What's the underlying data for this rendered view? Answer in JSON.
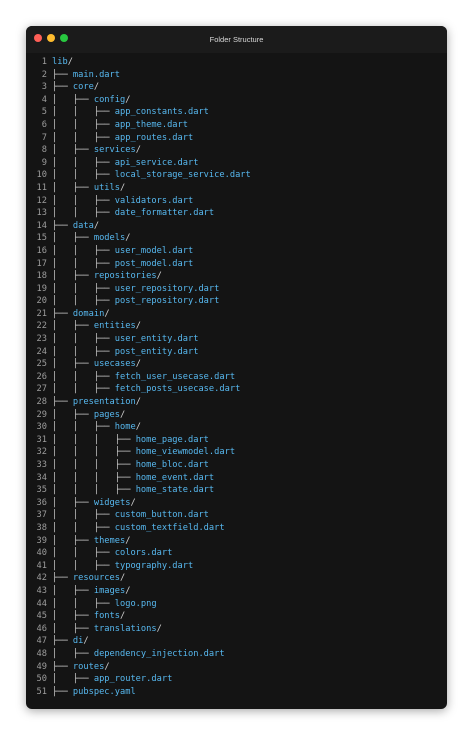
{
  "window": {
    "title": "Folder Structure",
    "controls": [
      {
        "name": "close-dot",
        "color": "#ff5f57"
      },
      {
        "name": "minimize-dot",
        "color": "#febc2e"
      },
      {
        "name": "maximize-dot",
        "color": "#28c840"
      }
    ]
  },
  "colors": {
    "background": "#141414",
    "names": "#57b8ef",
    "tree": "#d2d2d2",
    "line_numbers": "#9c9c9c"
  },
  "lines": [
    {
      "n": "1",
      "prefix": "",
      "name": "lib",
      "slash": "/"
    },
    {
      "n": "2",
      "prefix": "├── ",
      "name": "main.dart",
      "slash": ""
    },
    {
      "n": "3",
      "prefix": "├── ",
      "name": "core",
      "slash": "/"
    },
    {
      "n": "4",
      "prefix": "│   ├── ",
      "name": "config",
      "slash": "/"
    },
    {
      "n": "5",
      "prefix": "│   │   ├── ",
      "name": "app_constants.dart",
      "slash": ""
    },
    {
      "n": "6",
      "prefix": "│   │   ├── ",
      "name": "app_theme.dart",
      "slash": ""
    },
    {
      "n": "7",
      "prefix": "│   │   ├── ",
      "name": "app_routes.dart",
      "slash": ""
    },
    {
      "n": "8",
      "prefix": "│   ├── ",
      "name": "services",
      "slash": "/"
    },
    {
      "n": "9",
      "prefix": "│   │   ├── ",
      "name": "api_service.dart",
      "slash": ""
    },
    {
      "n": "10",
      "prefix": "│   │   ├── ",
      "name": "local_storage_service.dart",
      "slash": ""
    },
    {
      "n": "11",
      "prefix": "│   ├── ",
      "name": "utils",
      "slash": "/"
    },
    {
      "n": "12",
      "prefix": "│   │   ├── ",
      "name": "validators.dart",
      "slash": ""
    },
    {
      "n": "13",
      "prefix": "│   │   ├── ",
      "name": "date_formatter.dart",
      "slash": ""
    },
    {
      "n": "14",
      "prefix": "├── ",
      "name": "data",
      "slash": "/"
    },
    {
      "n": "15",
      "prefix": "│   ├── ",
      "name": "models",
      "slash": "/"
    },
    {
      "n": "16",
      "prefix": "│   │   ├── ",
      "name": "user_model.dart",
      "slash": ""
    },
    {
      "n": "17",
      "prefix": "│   │   ├── ",
      "name": "post_model.dart",
      "slash": ""
    },
    {
      "n": "18",
      "prefix": "│   ├── ",
      "name": "repositories",
      "slash": "/"
    },
    {
      "n": "19",
      "prefix": "│   │   ├── ",
      "name": "user_repository.dart",
      "slash": ""
    },
    {
      "n": "20",
      "prefix": "│   │   ├── ",
      "name": "post_repository.dart",
      "slash": ""
    },
    {
      "n": "21",
      "prefix": "├── ",
      "name": "domain",
      "slash": "/"
    },
    {
      "n": "22",
      "prefix": "│   ├── ",
      "name": "entities",
      "slash": "/"
    },
    {
      "n": "23",
      "prefix": "│   │   ├── ",
      "name": "user_entity.dart",
      "slash": ""
    },
    {
      "n": "24",
      "prefix": "│   │   ├── ",
      "name": "post_entity.dart",
      "slash": ""
    },
    {
      "n": "25",
      "prefix": "│   ├── ",
      "name": "usecases",
      "slash": "/"
    },
    {
      "n": "26",
      "prefix": "│   │   ├── ",
      "name": "fetch_user_usecase.dart",
      "slash": ""
    },
    {
      "n": "27",
      "prefix": "│   │   ├── ",
      "name": "fetch_posts_usecase.dart",
      "slash": ""
    },
    {
      "n": "28",
      "prefix": "├── ",
      "name": "presentation",
      "slash": "/"
    },
    {
      "n": "29",
      "prefix": "│   ├── ",
      "name": "pages",
      "slash": "/"
    },
    {
      "n": "30",
      "prefix": "│   │   ├── ",
      "name": "home",
      "slash": "/"
    },
    {
      "n": "31",
      "prefix": "│   │   │   ├── ",
      "name": "home_page.dart",
      "slash": ""
    },
    {
      "n": "32",
      "prefix": "│   │   │   ├── ",
      "name": "home_viewmodel.dart",
      "slash": ""
    },
    {
      "n": "33",
      "prefix": "│   │   │   ├── ",
      "name": "home_bloc.dart",
      "slash": ""
    },
    {
      "n": "34",
      "prefix": "│   │   │   ├── ",
      "name": "home_event.dart",
      "slash": ""
    },
    {
      "n": "35",
      "prefix": "│   │   │   ├── ",
      "name": "home_state.dart",
      "slash": ""
    },
    {
      "n": "36",
      "prefix": "│   ├── ",
      "name": "widgets",
      "slash": "/"
    },
    {
      "n": "37",
      "prefix": "│   │   ├── ",
      "name": "custom_button.dart",
      "slash": ""
    },
    {
      "n": "38",
      "prefix": "│   │   ├── ",
      "name": "custom_textfield.dart",
      "slash": ""
    },
    {
      "n": "39",
      "prefix": "│   ├── ",
      "name": "themes",
      "slash": "/"
    },
    {
      "n": "40",
      "prefix": "│   │   ├── ",
      "name": "colors.dart",
      "slash": ""
    },
    {
      "n": "41",
      "prefix": "│   │   ├── ",
      "name": "typography.dart",
      "slash": ""
    },
    {
      "n": "42",
      "prefix": "├── ",
      "name": "resources",
      "slash": "/"
    },
    {
      "n": "43",
      "prefix": "│   ├── ",
      "name": "images",
      "slash": "/"
    },
    {
      "n": "44",
      "prefix": "│   │   ├── ",
      "name": "logo.png",
      "slash": ""
    },
    {
      "n": "45",
      "prefix": "│   ├── ",
      "name": "fonts",
      "slash": "/"
    },
    {
      "n": "46",
      "prefix": "│   ├── ",
      "name": "translations",
      "slash": "/"
    },
    {
      "n": "47",
      "prefix": "├── ",
      "name": "di",
      "slash": "/"
    },
    {
      "n": "48",
      "prefix": "│   ├── ",
      "name": "dependency_injection.dart",
      "slash": ""
    },
    {
      "n": "49",
      "prefix": "├── ",
      "name": "routes",
      "slash": "/"
    },
    {
      "n": "50",
      "prefix": "│   ├── ",
      "name": "app_router.dart",
      "slash": ""
    },
    {
      "n": "51",
      "prefix": "├── ",
      "name": "pubspec.yaml",
      "slash": ""
    }
  ]
}
